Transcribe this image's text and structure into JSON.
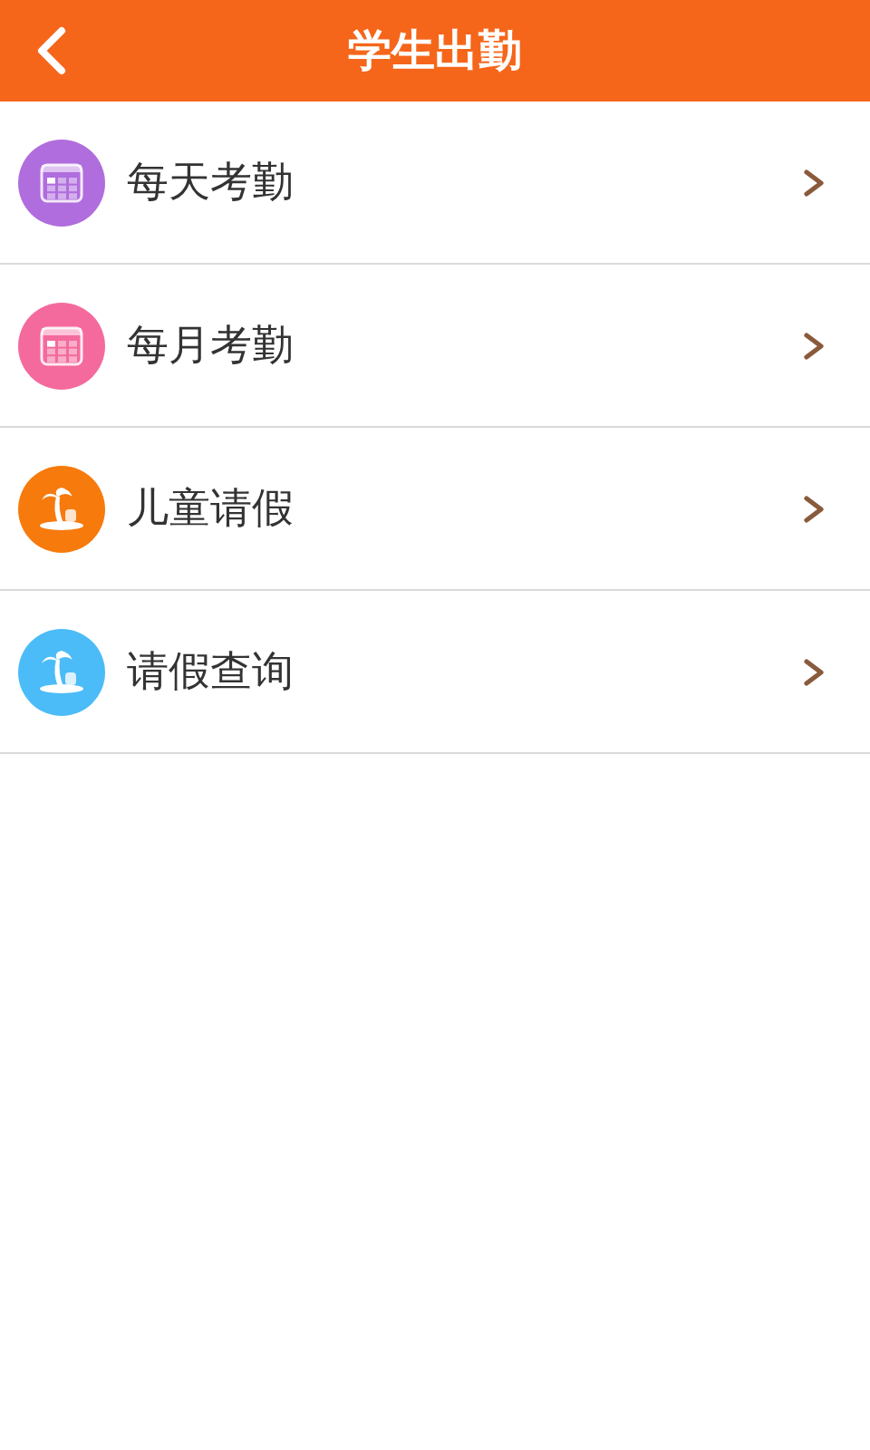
{
  "header": {
    "title": "学生出勤"
  },
  "menu": [
    {
      "label": "每天考勤",
      "kind": "calendar",
      "color": "#b06ddd"
    },
    {
      "label": "每月考勤",
      "kind": "calendar",
      "color": "#f46a9c"
    },
    {
      "label": "儿童请假",
      "kind": "island",
      "color": "#f77a0c"
    },
    {
      "label": "请假查询",
      "kind": "island",
      "color": "#4bbcf7"
    }
  ]
}
